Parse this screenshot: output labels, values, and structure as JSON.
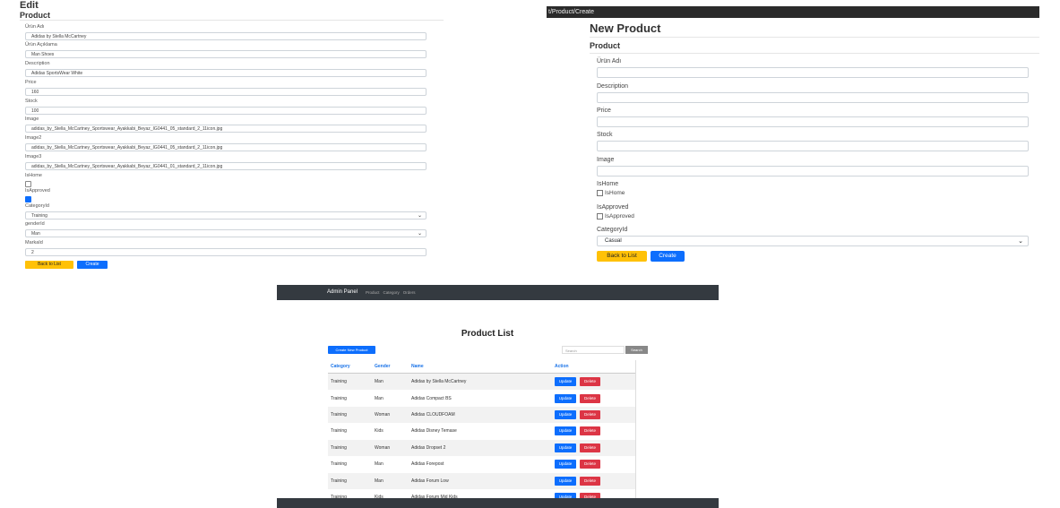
{
  "edit": {
    "title": "Edit",
    "subtitle": "Product",
    "fields": [
      {
        "label": "Ürün Adı",
        "value": "Adidas by Stella McCartney"
      },
      {
        "label": "Ürün Açıklama",
        "value": "Man Shoes"
      },
      {
        "label": "Description",
        "value": "Adidas SportsWear White"
      },
      {
        "label": "Price",
        "value": "160"
      },
      {
        "label": "Stock",
        "value": "100"
      },
      {
        "label": "Image",
        "value": "adidas_by_Stella_McCartney_Sportswear_Ayakkabi_Beyaz_IG0441_05_standard_2_11icon.jpg"
      },
      {
        "label": "Image2",
        "value": "adidas_by_Stella_McCartney_Sportswear_Ayakkabi_Beyaz_IG0441_05_standard_2_11icon.jpg"
      },
      {
        "label": "Image3",
        "value": "adidas_by_Stella_McCartney_Sportswear_Ayakkabi_Beyaz_IG0441_01_standard_2_11icon.jpg"
      }
    ],
    "ishome_label": "IsHome",
    "ishome_checked": false,
    "isapproved_label": "IsApproved",
    "isapproved_checked": true,
    "categoryid_label": "CategoryId",
    "categoryid_value": "Training",
    "genderid_label": "genderId",
    "genderid_value": "Man",
    "markaid_label": "MarkaId",
    "markaid_value": "2",
    "back_label": "Back to List",
    "create_label": "Create"
  },
  "new": {
    "url": "t/Product/Create",
    "title": "New Product",
    "subtitle": "Product",
    "fields": [
      {
        "label": "Ürün Adı",
        "value": ""
      },
      {
        "label": "Description",
        "value": ""
      },
      {
        "label": "Price",
        "value": ""
      },
      {
        "label": "Stock",
        "value": ""
      },
      {
        "label": "Image",
        "value": ""
      }
    ],
    "ishome_label": "IsHome",
    "ishome_check_label": "IsHome",
    "isapproved_label": "IsApproved",
    "isapproved_check_label": "IsApproved",
    "categoryid_label": "CategoryId",
    "categoryid_value": "Casual",
    "back_label": "Back to List",
    "create_label": "Create"
  },
  "list": {
    "brand": "Admin Panel",
    "nav": [
      "Product",
      "Category",
      "Orders"
    ],
    "title": "Product List",
    "create_label": "Create New Product",
    "search_placeholder": "Search",
    "search_button": "Search",
    "headers": {
      "category": "Category",
      "gender": "Gender",
      "name": "Name",
      "action": "Action"
    },
    "update_label": "Update",
    "delete_label": "Delete",
    "rows": [
      {
        "category": "Training",
        "gender": "Man",
        "name": "Adidas by Stella McCartney"
      },
      {
        "category": "Training",
        "gender": "Man",
        "name": "Adidas Compact BS"
      },
      {
        "category": "Training",
        "gender": "Woman",
        "name": "Adidas CLOUDFOAM"
      },
      {
        "category": "Training",
        "gender": "Kids",
        "name": "Adidas Disney Temase"
      },
      {
        "category": "Training",
        "gender": "Woman",
        "name": "Adidas Dropset 2"
      },
      {
        "category": "Training",
        "gender": "Man",
        "name": "Adidas Forepost"
      },
      {
        "category": "Training",
        "gender": "Man",
        "name": "Adidas Forum Low"
      },
      {
        "category": "Training",
        "gender": "Kids",
        "name": "Adidas Forum Mid Kids"
      }
    ]
  },
  "colors": {
    "primary": "#0d6efd",
    "warning": "#ffc107",
    "danger": "#dc3545",
    "dark": "#343a40"
  }
}
